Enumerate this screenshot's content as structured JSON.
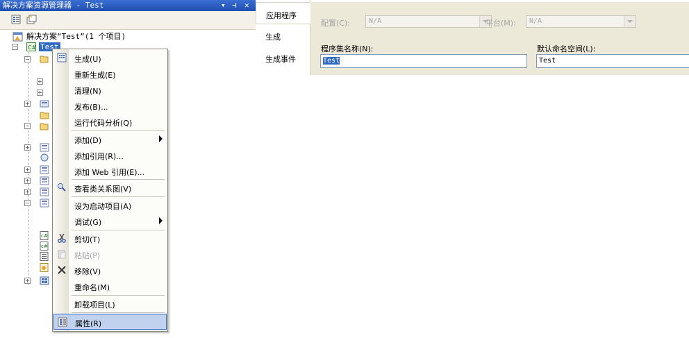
{
  "solution_explorer": {
    "title": "解决方案资源管理器 - Test",
    "controls": {
      "pin": "▾",
      "dock": "⊣",
      "close": "✕"
    },
    "solution_label": "解决方案“Test”(1 个项目)",
    "project_label": "Test"
  },
  "context_menu": {
    "items": [
      {
        "label": "生成(U)"
      },
      {
        "label": "重新生成(E)"
      },
      {
        "label": "清理(N)"
      },
      {
        "label": "发布(B)..."
      },
      {
        "label": "运行代码分析(Q)"
      },
      {
        "label": "添加(D)"
      },
      {
        "label": "添加引用(R)..."
      },
      {
        "label": "添加 Web 引用(E)..."
      },
      {
        "label": "查看类关系图(V)"
      },
      {
        "label": "设为启动项目(A)"
      },
      {
        "label": "调试(G)"
      },
      {
        "label": "剪切(T)"
      },
      {
        "label": "粘贴(P)"
      },
      {
        "label": "移除(V)"
      },
      {
        "label": "重命名(M)"
      },
      {
        "label": "卸载项目(L)"
      },
      {
        "label": "属性(R)"
      }
    ]
  },
  "properties": {
    "tabs": [
      {
        "label": "应用程序"
      },
      {
        "label": "生成"
      },
      {
        "label": "生成事件"
      }
    ],
    "config_label": "配置(C):",
    "config_value": "N/A",
    "platform_label": "平台(M):",
    "platform_value": "N/A",
    "assembly_name_label": "程序集名称(N):",
    "assembly_name_value": "Test",
    "namespace_label": "默认命名空间(L):",
    "namespace_value": "Test"
  },
  "colors": {
    "title_bar": "#2a5bc2",
    "selection": "#316ac5",
    "menu_highlight": "#c1d2ee",
    "panel_bg": "#ece9d8"
  }
}
